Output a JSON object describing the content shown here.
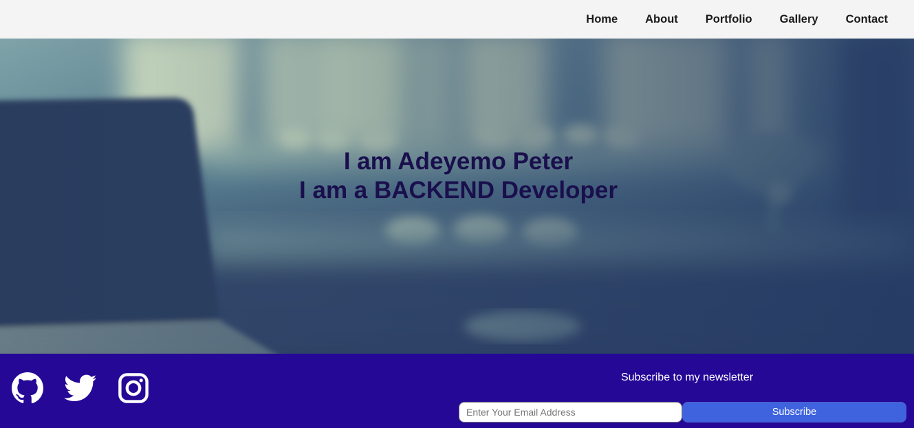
{
  "nav": {
    "items": [
      {
        "label": "Home"
      },
      {
        "label": "About"
      },
      {
        "label": "Portfolio"
      },
      {
        "label": "Gallery"
      },
      {
        "label": "Contact"
      }
    ]
  },
  "hero": {
    "line1": "I am Adeyemo Peter",
    "line2": "I am a BACKEND Developer"
  },
  "footer": {
    "social": [
      {
        "icon": "github-icon"
      },
      {
        "icon": "twitter-icon"
      },
      {
        "icon": "instagram-icon"
      }
    ],
    "newsletter": {
      "title": "Subscribe to my newsletter",
      "email_placeholder": "Enter Your Email Address",
      "email_value": "",
      "button_label": "Subscribe"
    }
  },
  "colors": {
    "footer_bg": "#250896",
    "hero_text": "#1a0f4d",
    "button_bg": "#3f63de"
  }
}
